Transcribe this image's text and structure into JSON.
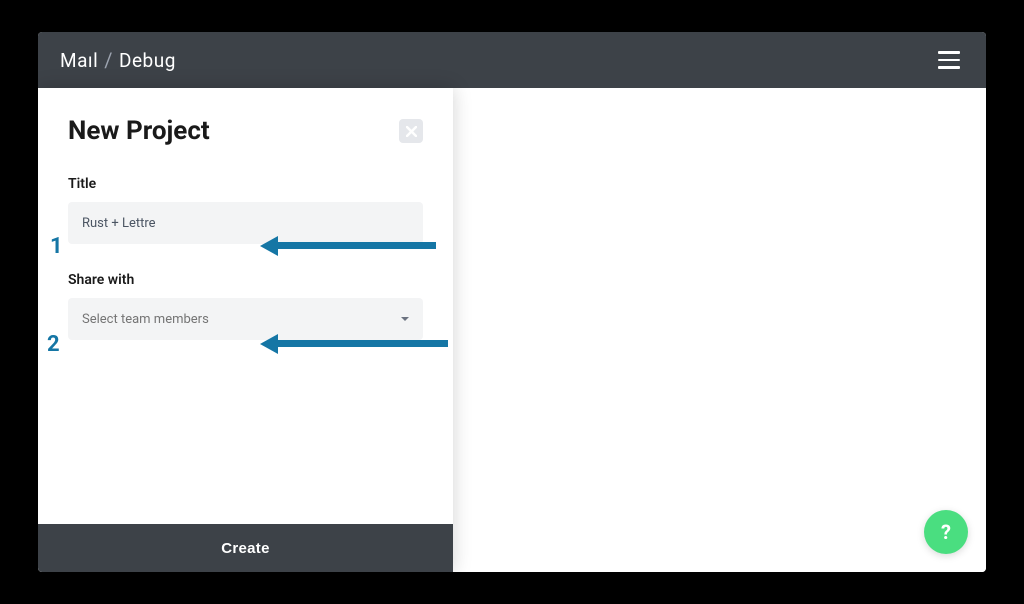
{
  "header": {
    "logo_part1": "Maıl",
    "logo_part2": "Debug"
  },
  "panel": {
    "title": "New Project",
    "fields": {
      "title_label": "Title",
      "title_value": "Rust + Lettre",
      "share_label": "Share with",
      "share_placeholder": "Select team members"
    },
    "create_label": "Create"
  },
  "help": {
    "label": "?"
  },
  "annotations": {
    "num1": "1",
    "num2": "2"
  }
}
